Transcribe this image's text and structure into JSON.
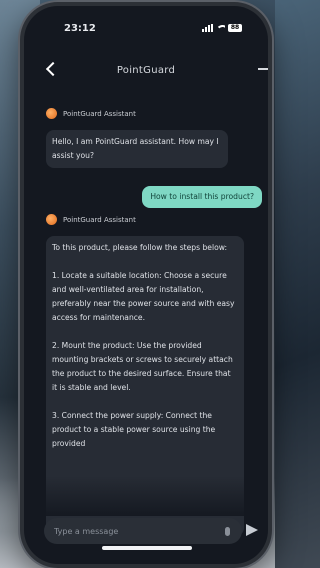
{
  "status_bar": {
    "time": "23:12",
    "battery": "88"
  },
  "header": {
    "title": "PointGuard"
  },
  "messages": {
    "m1": {
      "sender": "PointGuard Assistant",
      "text": "Hello, I am PointGuard assistant. How may I assist you?"
    },
    "m2": {
      "text": "How to install this product?"
    },
    "m3": {
      "sender": "PointGuard Assistant",
      "p1": "To this product, please follow the steps below:",
      "p2": "1. Locate a suitable location: Choose a secure and well-ventilated area for installation, preferably near the power source and with easy access for maintenance.",
      "p3": "2. Mount the product: Use the provided mounting brackets or screws to securely attach the product to the desired surface. Ensure that it is stable and level.",
      "p4": "3. Connect the power supply: Connect the product to a stable power source using the provided"
    }
  },
  "input": {
    "placeholder": "Type a message"
  },
  "colors": {
    "user_bubble": "#7fd8c4",
    "assistant_bubble": "#272c35",
    "screen_bg": "#141820",
    "avatar": "#e06a1c"
  },
  "icons": {
    "back": "back-icon",
    "more": "more-icon",
    "avatar": "avatar-icon",
    "mic": "mic-icon",
    "send": "send-icon"
  }
}
